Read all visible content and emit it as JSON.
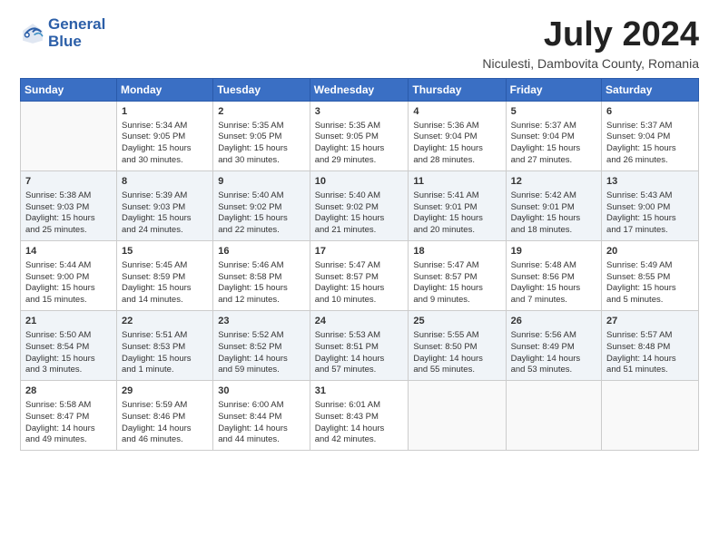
{
  "logo": {
    "line1": "General",
    "line2": "Blue"
  },
  "title": "July 2024",
  "location": "Niculesti, Dambovita County, Romania",
  "weekdays": [
    "Sunday",
    "Monday",
    "Tuesday",
    "Wednesday",
    "Thursday",
    "Friday",
    "Saturday"
  ],
  "weeks": [
    [
      {
        "day": "",
        "info": ""
      },
      {
        "day": "1",
        "info": "Sunrise: 5:34 AM\nSunset: 9:05 PM\nDaylight: 15 hours\nand 30 minutes."
      },
      {
        "day": "2",
        "info": "Sunrise: 5:35 AM\nSunset: 9:05 PM\nDaylight: 15 hours\nand 30 minutes."
      },
      {
        "day": "3",
        "info": "Sunrise: 5:35 AM\nSunset: 9:05 PM\nDaylight: 15 hours\nand 29 minutes."
      },
      {
        "day": "4",
        "info": "Sunrise: 5:36 AM\nSunset: 9:04 PM\nDaylight: 15 hours\nand 28 minutes."
      },
      {
        "day": "5",
        "info": "Sunrise: 5:37 AM\nSunset: 9:04 PM\nDaylight: 15 hours\nand 27 minutes."
      },
      {
        "day": "6",
        "info": "Sunrise: 5:37 AM\nSunset: 9:04 PM\nDaylight: 15 hours\nand 26 minutes."
      }
    ],
    [
      {
        "day": "7",
        "info": "Sunrise: 5:38 AM\nSunset: 9:03 PM\nDaylight: 15 hours\nand 25 minutes."
      },
      {
        "day": "8",
        "info": "Sunrise: 5:39 AM\nSunset: 9:03 PM\nDaylight: 15 hours\nand 24 minutes."
      },
      {
        "day": "9",
        "info": "Sunrise: 5:40 AM\nSunset: 9:02 PM\nDaylight: 15 hours\nand 22 minutes."
      },
      {
        "day": "10",
        "info": "Sunrise: 5:40 AM\nSunset: 9:02 PM\nDaylight: 15 hours\nand 21 minutes."
      },
      {
        "day": "11",
        "info": "Sunrise: 5:41 AM\nSunset: 9:01 PM\nDaylight: 15 hours\nand 20 minutes."
      },
      {
        "day": "12",
        "info": "Sunrise: 5:42 AM\nSunset: 9:01 PM\nDaylight: 15 hours\nand 18 minutes."
      },
      {
        "day": "13",
        "info": "Sunrise: 5:43 AM\nSunset: 9:00 PM\nDaylight: 15 hours\nand 17 minutes."
      }
    ],
    [
      {
        "day": "14",
        "info": "Sunrise: 5:44 AM\nSunset: 9:00 PM\nDaylight: 15 hours\nand 15 minutes."
      },
      {
        "day": "15",
        "info": "Sunrise: 5:45 AM\nSunset: 8:59 PM\nDaylight: 15 hours\nand 14 minutes."
      },
      {
        "day": "16",
        "info": "Sunrise: 5:46 AM\nSunset: 8:58 PM\nDaylight: 15 hours\nand 12 minutes."
      },
      {
        "day": "17",
        "info": "Sunrise: 5:47 AM\nSunset: 8:57 PM\nDaylight: 15 hours\nand 10 minutes."
      },
      {
        "day": "18",
        "info": "Sunrise: 5:47 AM\nSunset: 8:57 PM\nDaylight: 15 hours\nand 9 minutes."
      },
      {
        "day": "19",
        "info": "Sunrise: 5:48 AM\nSunset: 8:56 PM\nDaylight: 15 hours\nand 7 minutes."
      },
      {
        "day": "20",
        "info": "Sunrise: 5:49 AM\nSunset: 8:55 PM\nDaylight: 15 hours\nand 5 minutes."
      }
    ],
    [
      {
        "day": "21",
        "info": "Sunrise: 5:50 AM\nSunset: 8:54 PM\nDaylight: 15 hours\nand 3 minutes."
      },
      {
        "day": "22",
        "info": "Sunrise: 5:51 AM\nSunset: 8:53 PM\nDaylight: 15 hours\nand 1 minute."
      },
      {
        "day": "23",
        "info": "Sunrise: 5:52 AM\nSunset: 8:52 PM\nDaylight: 14 hours\nand 59 minutes."
      },
      {
        "day": "24",
        "info": "Sunrise: 5:53 AM\nSunset: 8:51 PM\nDaylight: 14 hours\nand 57 minutes."
      },
      {
        "day": "25",
        "info": "Sunrise: 5:55 AM\nSunset: 8:50 PM\nDaylight: 14 hours\nand 55 minutes."
      },
      {
        "day": "26",
        "info": "Sunrise: 5:56 AM\nSunset: 8:49 PM\nDaylight: 14 hours\nand 53 minutes."
      },
      {
        "day": "27",
        "info": "Sunrise: 5:57 AM\nSunset: 8:48 PM\nDaylight: 14 hours\nand 51 minutes."
      }
    ],
    [
      {
        "day": "28",
        "info": "Sunrise: 5:58 AM\nSunset: 8:47 PM\nDaylight: 14 hours\nand 49 minutes."
      },
      {
        "day": "29",
        "info": "Sunrise: 5:59 AM\nSunset: 8:46 PM\nDaylight: 14 hours\nand 46 minutes."
      },
      {
        "day": "30",
        "info": "Sunrise: 6:00 AM\nSunset: 8:44 PM\nDaylight: 14 hours\nand 44 minutes."
      },
      {
        "day": "31",
        "info": "Sunrise: 6:01 AM\nSunset: 8:43 PM\nDaylight: 14 hours\nand 42 minutes."
      },
      {
        "day": "",
        "info": ""
      },
      {
        "day": "",
        "info": ""
      },
      {
        "day": "",
        "info": ""
      }
    ]
  ]
}
